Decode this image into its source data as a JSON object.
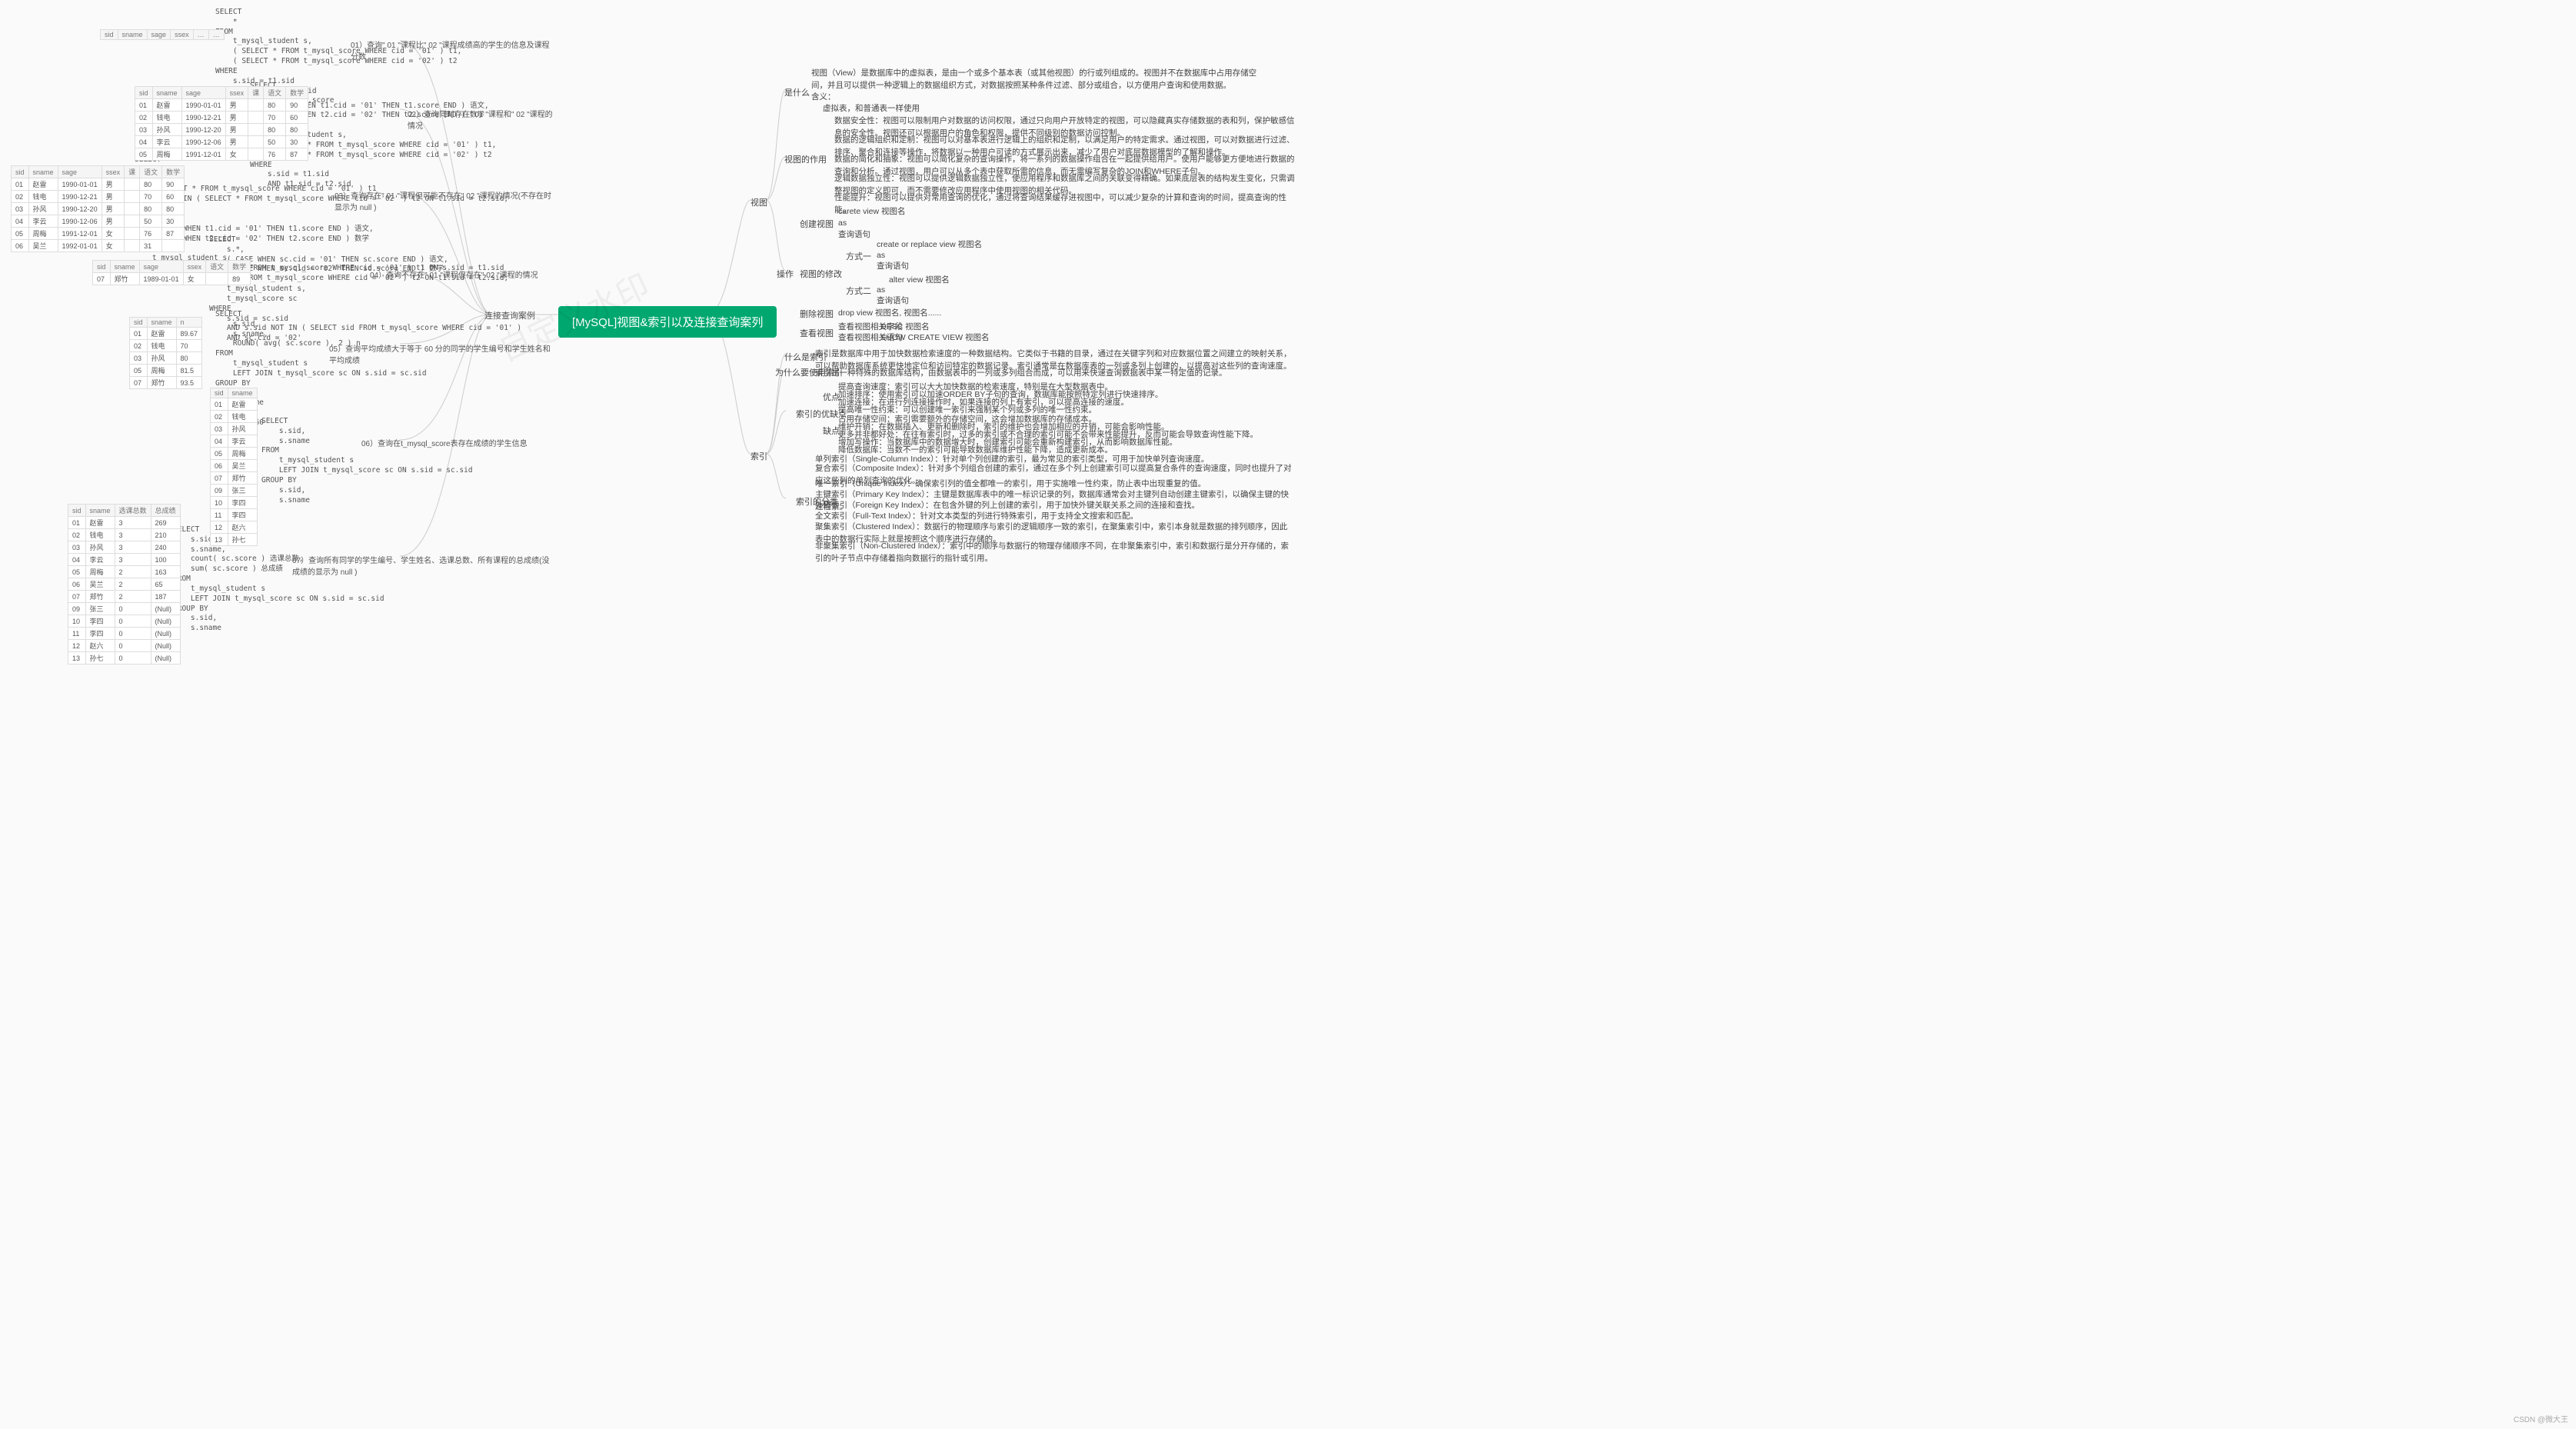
{
  "root": "[MySQL]视图&索引以及连接查询案列",
  "left_branch": "连接查询案例",
  "sql": {
    "q1": "SELECT\n    *\nFROM\n    t_mysql_student s,\n    ( SELECT * FROM t_mysql_score WHERE cid = '01' ) t1,\n    ( SELECT * FROM t_mysql_score WHERE cid = '02' ) t2\nWHERE\n    s.sid = t1.sid\n    AND t1.sid = t2.sid\n    AND t1.score > t2.score",
    "q2": "SELECT\n    s.*,\n    ( CASE WHEN t1.cid = '01' THEN t1.score END ) 语文,\n    ( CASE WHEN t2.cid = '02' THEN t2.score END ) 数学\nFROM\n    t_mysql_student s,\n    ( SELECT * FROM t_mysql_score WHERE cid = '01' ) t1,\n    ( SELECT * FROM t_mysql_score WHERE cid = '02' ) t2\nWHERE\n    s.sid = t1.sid\n    AND t1.sid = t2.sid",
    "q3": "SELECT\n    *\nFROM\n    ( SELECT * FROM t_mysql_score WHERE cid = '01' ) t1\n    LEFT JOIN ( SELECT * FROM t_mysql_score WHERE cid = '02' ) t2 ON t1.sid = t2.sid;\nSELECT\n    s.*,\n    ( CASE WHEN t1.cid = '01' THEN t1.score END ) 语文,\n    ( CASE WHEN t2.cid = '02' THEN t2.score END ) 数学\nFROM\n    t_mysql_student s\n    INNER JOIN ( SELECT * FROM t_mysql_score WHERE cid = '01' ) t1 ON s.sid = t1.sid\n    LEFT JOIN ( SELECT * FROM t_mysql_score WHERE cid = '02' ) t2 ON t1.sid = t2.sid;",
    "q4": "SELECT\n    s.*,\n    ( CASE WHEN sc.cid = '01' THEN sc.score END ) 语文,\n    ( CASE WHEN sc.cid = '02' THEN sc.score END ) 数学\nFROM\n    t_mysql_student s,\n    t_mysql_score sc\nWHERE\n    s.sid = sc.sid\n    AND s.sid NOT IN ( SELECT sid FROM t_mysql_score WHERE cid = '01' )\n    AND sc.cid = '02'",
    "q5": "SELECT\n    s.sid,\n    s.sname,\n    ROUND( avg( sc.score ), 2 ) n\nFROM\n    t_mysql_student s\n    LEFT JOIN t_mysql_score sc ON s.sid = sc.sid\nGROUP BY\n    s.sid,\n    s.sname\nHAVING\n    n >= 60",
    "q6": "SELECT\n    s.sid,\n    s.sname\nFROM\n    t_mysql_student s\n    LEFT JOIN t_mysql_score sc ON s.sid = sc.sid\nGROUP BY\n    s.sid,\n    s.sname",
    "q7": "SELECT\n    s.sid,\n    s.sname,\n    count( sc.score ) 选课总数,\n    sum( sc.score ) 总成绩\nFROM\n    t_mysql_student s\n    LEFT JOIN t_mysql_score sc ON s.sid = sc.sid\nGROUP BY\n    s.sid,\n    s.sname"
  },
  "labels": {
    "q1": "01）查询\" 01 \"课程比\" 02 \"课程成绩高的学生的信息及课程分数",
    "q2": "02）查询同时存在\" 01 \"课程和\" 02 \"课程的情况",
    "q3": "03）查询存在\" 01 \"课程但可能不存在\" 02 \"课程的情况(不存在时显示为 null )",
    "q4": "04）查询不存在\" 01 \"课程但存在\" 02 \"课程的情况",
    "q5": "05）查询平均成绩大于等于 60 分的同学的学生编号和学生姓名和平均成绩",
    "q6": "06）查询在t_mysql_score表存在成绩的学生信息",
    "q7": "07）查询所有同学的学生编号、学生姓名、选课总数、所有课程的总成绩(没成绩的显示为 null )"
  },
  "tables": {
    "t2_header": [
      "sid",
      "sname",
      "sage",
      "ssex",
      "课",
      "语文",
      "数学"
    ],
    "t2_rows": [
      [
        "01",
        "赵雷",
        "1990-01-01",
        "男",
        "",
        "80",
        "90"
      ],
      [
        "02",
        "钱电",
        "1990-12-21",
        "男",
        "",
        "70",
        "60"
      ],
      [
        "03",
        "孙风",
        "1990-12-20",
        "男",
        "",
        "80",
        "80"
      ],
      [
        "04",
        "李云",
        "1990-12-06",
        "男",
        "",
        "50",
        "30"
      ],
      [
        "05",
        "周梅",
        "1991-12-01",
        "女",
        "",
        "76",
        "87"
      ]
    ],
    "t3_header": [
      "sid",
      "sname",
      "sage",
      "ssex",
      "课",
      "语文",
      "数学"
    ],
    "t3_rows": [
      [
        "01",
        "赵雷",
        "1990-01-01",
        "男",
        "",
        "80",
        "90"
      ],
      [
        "02",
        "钱电",
        "1990-12-21",
        "男",
        "",
        "70",
        "60"
      ],
      [
        "03",
        "孙风",
        "1990-12-20",
        "男",
        "",
        "80",
        "80"
      ],
      [
        "04",
        "李云",
        "1990-12-06",
        "男",
        "",
        "50",
        "30"
      ],
      [
        "05",
        "周梅",
        "1991-12-01",
        "女",
        "",
        "76",
        "87"
      ],
      [
        "06",
        "吴兰",
        "1992-01-01",
        "女",
        "",
        "31",
        ""
      ]
    ],
    "t4_header": [
      "sid",
      "sname",
      "sage",
      "ssex",
      "语文",
      "数学"
    ],
    "t4_rows": [
      [
        "07",
        "郑竹",
        "1989-01-01",
        "女",
        "",
        "89"
      ]
    ],
    "t5_header": [
      "sid",
      "sname",
      "n"
    ],
    "t5_rows": [
      [
        "01",
        "赵雷",
        "89.67"
      ],
      [
        "02",
        "钱电",
        "70"
      ],
      [
        "03",
        "孙风",
        "80"
      ],
      [
        "05",
        "周梅",
        "81.5"
      ],
      [
        "07",
        "郑竹",
        "93.5"
      ]
    ],
    "t6_header": [
      "sid",
      "sname"
    ],
    "t6_rows": [
      [
        "01",
        "赵雷"
      ],
      [
        "02",
        "钱电"
      ],
      [
        "03",
        "孙风"
      ],
      [
        "04",
        "李云"
      ],
      [
        "05",
        "周梅"
      ],
      [
        "06",
        "吴兰"
      ],
      [
        "07",
        "郑竹"
      ],
      [
        "09",
        "张三"
      ],
      [
        "10",
        "李四"
      ],
      [
        "11",
        "李四"
      ],
      [
        "12",
        "赵六"
      ],
      [
        "13",
        "孙七"
      ]
    ],
    "t7_header": [
      "sid",
      "sname",
      "选课总数",
      "总成绩"
    ],
    "t7_rows": [
      [
        "01",
        "赵雷",
        "3",
        "269"
      ],
      [
        "02",
        "钱电",
        "3",
        "210"
      ],
      [
        "03",
        "孙风",
        "3",
        "240"
      ],
      [
        "04",
        "李云",
        "3",
        "100"
      ],
      [
        "05",
        "周梅",
        "2",
        "163"
      ],
      [
        "06",
        "吴兰",
        "2",
        "65"
      ],
      [
        "07",
        "郑竹",
        "2",
        "187"
      ],
      [
        "09",
        "张三",
        "0",
        "(Null)"
      ],
      [
        "10",
        "李四",
        "0",
        "(Null)"
      ],
      [
        "11",
        "李四",
        "0",
        "(Null)"
      ],
      [
        "12",
        "赵六",
        "0",
        "(Null)"
      ],
      [
        "13",
        "孙七",
        "0",
        "(Null)"
      ]
    ]
  },
  "right": {
    "view": "视图",
    "index": "索引",
    "what_is": "是什么",
    "what_def1": "视图（View）是数据库中的虚拟表，是由一个或多个基本表（或其他视图）的行或列组成的。视图并不在数据库中占用存储空间，并且可以提供一种逻辑上的数据组织方式，对数据按照某种条件过滤、部分或组合，以方便用户查询和使用数据。",
    "what_def2": "含义：",
    "what_def3": "虚拟表，和普通表一样使用",
    "usage": "视图的作用",
    "usage1": "数据安全性：视图可以限制用户对数据的访问权限，通过只向用户开放特定的视图，可以隐藏真实存储数据的表和列，保护敏感信息的安全性。视图还可以根据用户的角色和权限，提供不同级别的数据访问控制。",
    "usage2": "数据的逻辑组织和定制：视图可以对基本表进行逻辑上的组织和定制，以满足用户的特定需求。通过视图，可以对数据进行过滤、排序、聚合和连接等操作，将数据以一种用户可读的方式展示出来，减少了用户对底层数据模型的了解和操作。",
    "usage3": "数据的简化和抽象：视图可以简化复杂的查询操作，将一系列的数据操作组合在一起提供给用户。使用户能够更方便地进行数据的查询和分析。通过视图，用户可以从多个表中获取所需的信息，而无需编写复杂的JOIN和WHERE子句。",
    "usage4": "逻辑数据独立性：视图可以提供逻辑数据独立性，使应用程序和数据库之间的关联变得精确。如果底层表的结构发生变化，只需调整视图的定义即可，而不需要修改应用程序中使用视图的相关代码。",
    "usage5": "性能提升：视图可以提供对常用查询的优化，通过将查询结果缓存进视图中，可以减少复杂的计算和查询的时间，提高查询的性能。",
    "ops": "操作",
    "create_view": "创建视图",
    "create_1": "carete view 视图名",
    "create_2": "as",
    "create_3": "查询语句",
    "modify_view": "视图的修改",
    "modify_m1": "方式一",
    "modify_m1_1": "create or replace view 视图名",
    "modify_m1_2": "as",
    "modify_m1_3": "查询语句",
    "modify_m2": "方式二",
    "modify_m2_1": "alter view 视图名",
    "modify_m2_2": "as",
    "modify_m2_3": "查询语句",
    "drop_view": "删除视图",
    "drop_cmd": "drop view 视图名, 视图名......",
    "show_view": "查看视图",
    "show_1": "查看视图相关字段",
    "show_1v": "DESC 视图名",
    "show_2": "查看视图相关语句",
    "show_2v": "SHOW CREATE VIEW 视图名",
    "idx_what": "什么是索引",
    "idx_what_t": "索引是数据库中用于加快数据检索速度的一种数据结构。它类似于书籍的目录，通过在关键字列和对应数据位置之间建立的映射关系，可以帮助数据库系统更快地定位和访问特定的数据记录。索引通常是在数据库表的一列或多列上创建的，以提高对这些列的查询速度。",
    "idx_why": "为什么要使用索引",
    "idx_why_t": "索引是一种特殊的数据库结构，由数据表中的一列或多列组合而成，可以用来快速查询数据表中某一特定值的记录。",
    "idx_proscons": "索引的优缺点",
    "pros": "优点",
    "pros1": "提高查询速度：索引可以大大加快数据的检索速度，特别是在大型数据表中。",
    "pros2": "加速排序：使用索引可以加速ORDER BY子句的查询，数据库能按照特定列进行快速排序。",
    "pros3": "加速连接：在进行列连接操作时，如果连接的列上有索引，可以提高连接的速度。",
    "pros4": "提高唯一性约束：可以创建唯一索引来强制某个列或多列的唯一性约束。",
    "cons": "缺点",
    "cons1": "占用存储空间：索引需要额外的存储空间，这会增加数据库的存储成本。",
    "cons2": "维护开销：在数据插入、更新和删除时，索引的维护也会增加相应的开销，可能会影响性能。",
    "cons3": "更多并非都好处：在往有索引时，过多的索引或不合理的索引可能不会带来性能提升，反而可能会导致查询性能下降。",
    "cons4": "增加写操作：当数据库中的数据增大时，创建索引可能会重新构建索引，从而影响数据库性能。",
    "cons5": "降低数据库：当数不一的索引可能导致数据库维护性能下降，造成更新成本。",
    "idx_types": "索引的分类",
    "type1": "单列索引（Single-Column Index）：针对单个列创建的索引，最为常见的索引类型，可用于加快单列查询速度。",
    "type2": "复合索引（Composite Index）：针对多个列组合创建的索引，通过在多个列上创建索引可以提高复合条件的查询速度，同时也提升了对应这些列的单列查询的优化。",
    "type3": "唯一索引（Unique Index）：确保索引列的值全都唯一的索引，用于实施唯一性约束，防止表中出现重复的值。",
    "type4": "主键索引（Primary Key Index）：主键是数据库表中的唯一标识记录的列，数据库通常会对主键列自动创建主键索引，以确保主键的快速检索。",
    "type5": "外键索引（Foreign Key Index）：在包含外键的列上创建的索引，用于加快外键关联关系之间的连接和查找。",
    "type6": "全文索引（Full-Text Index）：针对文本类型的列进行特殊索引，用于支持全文搜索和匹配。",
    "type7": "聚集索引（Clustered Index）：数据行的物理顺序与索引的逻辑顺序一致的索引，在聚集索引中，索引本身就是数据的排列顺序，因此表中的数据行实际上就是按照这个顺序进行存储的。",
    "type8": "非聚集索引（Non-Clustered Index）：索引中的顺序与数据行的物理存储顺序不同，在非聚集索引中，索引和数据行是分开存储的，索引的叶子节点中存储着指向数据行的指针或引用。"
  },
  "watermark": "CSDN @微大王"
}
